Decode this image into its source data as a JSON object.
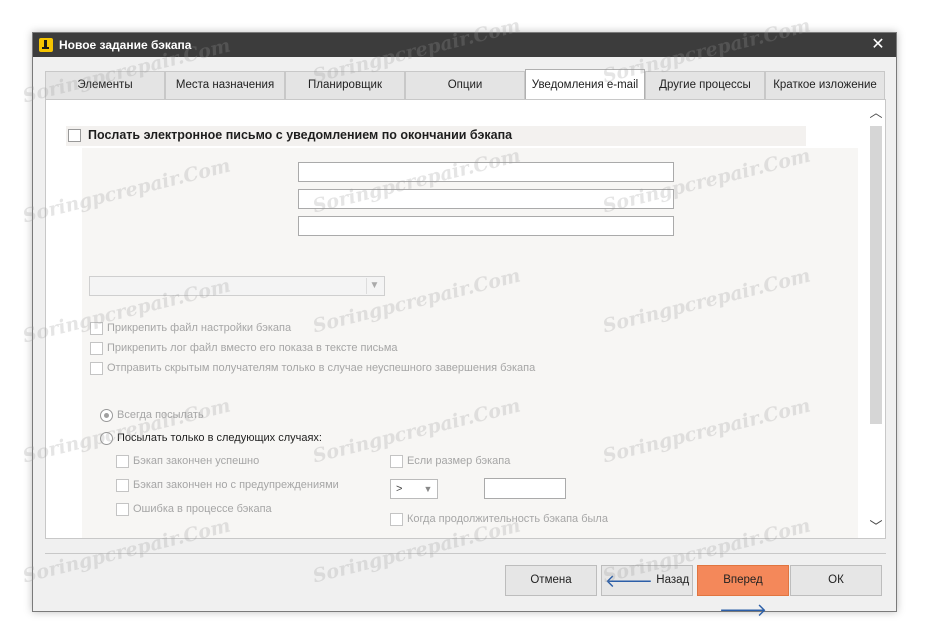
{
  "window": {
    "title": "Новое задание бэкапа",
    "close_glyph": "✕"
  },
  "tabs": [
    {
      "label": "Элементы"
    },
    {
      "label": "Места назначения"
    },
    {
      "label": "Планировщик"
    },
    {
      "label": "Опции"
    },
    {
      "label": "Уведомления e-mail"
    },
    {
      "label": "Другие процессы"
    },
    {
      "label": "Краткое изложение"
    }
  ],
  "active_tab": "Уведомления e-mail",
  "panel": {
    "send_email_label": "Послать электронное письмо с уведомлением по окончании бэкапа",
    "send_email_checked": false,
    "attach_settings_label": "Прикрепить файл настройки бэкапа",
    "attach_log_label": "Прикрепить лог файл вместо его показа в тексте письма",
    "bcc_on_failure_label": "Отправить скрытым получателям только в случае неуспешного завершения бэкапа",
    "always_send_label": "Всегда посылать",
    "send_only_label": "Посылать только в следующих случаях:",
    "success_label": "Бэкап закончен успешно",
    "warnings_label": "Бэкап закончен но с предупреждениями",
    "error_label": "Ошибка в процессе бэкапа",
    "if_size_label": "Если размер бэкапа",
    "size_operator": ">",
    "duration_label": "Когда продолжительность бэкапа была"
  },
  "buttons": {
    "cancel": "Отмена",
    "back": "Назад",
    "next": "Вперед",
    "ok": "ОК"
  },
  "icons": {
    "back": "arrow-left-icon",
    "next": "arrow-right-icon",
    "scroll_up": "chevron-up-icon",
    "scroll_down": "chevron-down-icon"
  },
  "watermark": "Soringpcrepair.Com",
  "colors": {
    "titlebar": "#3c3c3c",
    "primary_button": "#f4885a",
    "arrow": "#2c5fa8"
  }
}
